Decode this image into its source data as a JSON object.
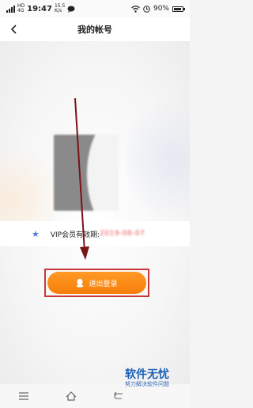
{
  "status_bar": {
    "network_top": "HD",
    "network_bottom": "4G",
    "time": "19:47",
    "speed_top": "15.5",
    "speed_bottom": "K/s",
    "battery": "90%",
    "battery_level": 0.9,
    "icons": [
      "signal-icon",
      "message-icon",
      "wifi-icon",
      "clock-icon",
      "battery-icon"
    ]
  },
  "header": {
    "title": "我的帐号",
    "back_icon": "back-icon"
  },
  "vip": {
    "label": "VIP会员有效期:",
    "date": "2019-08-07",
    "icon": "star-icon",
    "star_color": "#4a7bd4"
  },
  "logout": {
    "label": "退出登录",
    "icon": "qq-icon",
    "button_color": "#f7860f",
    "highlight_color": "#c8383a"
  },
  "bottom_nav": {
    "icons": [
      "menu-icon",
      "home-icon",
      "back-nav-icon"
    ]
  },
  "watermark": {
    "title": "软件无忧",
    "subtitle": "努力解决软件问题"
  }
}
